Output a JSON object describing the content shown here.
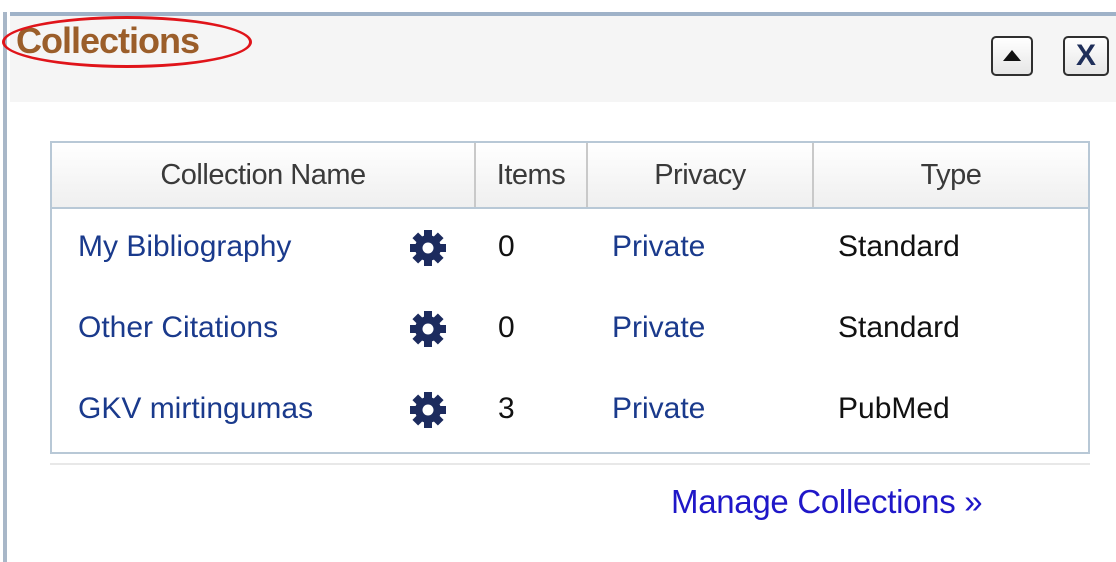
{
  "panel": {
    "title": "Collections",
    "collapse_button": "collapse",
    "close_label": "X"
  },
  "table": {
    "headers": [
      "Collection Name",
      "Items",
      "Privacy",
      "Type"
    ],
    "rows": [
      {
        "name": "My Bibliography",
        "items": "0",
        "privacy": "Private",
        "type": "Standard",
        "icon": "gear-icon"
      },
      {
        "name": "Other Citations",
        "items": "0",
        "privacy": "Private",
        "type": "Standard",
        "icon": "gear-icon"
      },
      {
        "name": "GKV mirtingumas",
        "items": "3",
        "privacy": "Private",
        "type": "PubMed",
        "icon": "gear-icon"
      }
    ]
  },
  "footer": {
    "manage_link": "Manage Collections »"
  },
  "colors": {
    "title": "#9b5e2a",
    "link": "#1a3a8c",
    "manage_link": "#1f17c8",
    "highlight_ring": "#e0141a"
  }
}
